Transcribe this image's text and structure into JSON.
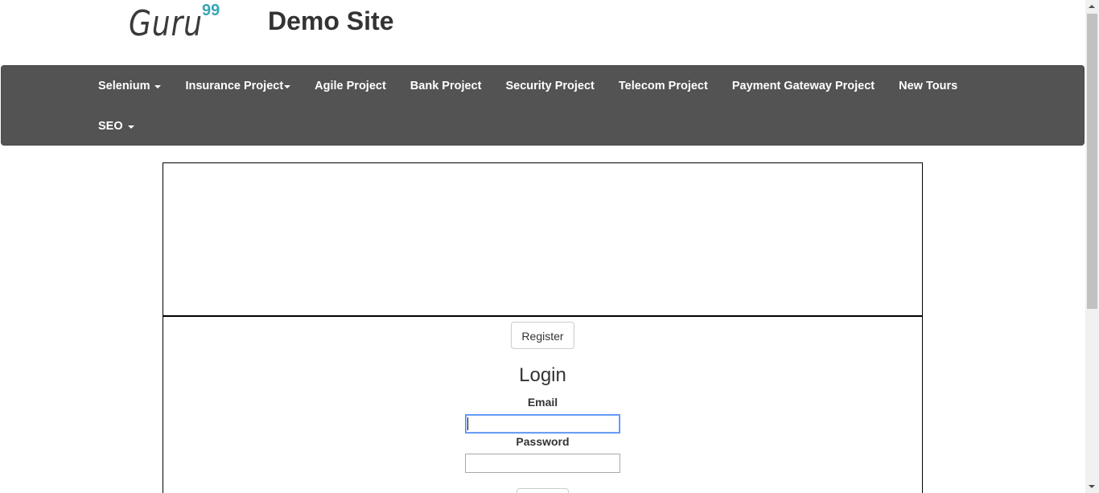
{
  "header": {
    "logo_text": "Guru",
    "logo_sup": "99",
    "title": "Demo Site"
  },
  "nav": {
    "row1": [
      {
        "label": "Selenium",
        "dropdown": true
      },
      {
        "label": "Insurance Project",
        "dropdown": true
      },
      {
        "label": "Agile Project",
        "dropdown": false
      },
      {
        "label": "Bank Project",
        "dropdown": false
      },
      {
        "label": "Security Project",
        "dropdown": false
      },
      {
        "label": "Telecom Project",
        "dropdown": false
      },
      {
        "label": "Payment Gateway Project",
        "dropdown": false
      },
      {
        "label": "New Tours",
        "dropdown": false
      }
    ],
    "row2": [
      {
        "label": "SEO",
        "dropdown": true
      }
    ]
  },
  "main": {
    "register_label": "Register",
    "login_title": "Login",
    "email_label": "Email",
    "email_value": "",
    "password_label": "Password",
    "password_value": ""
  },
  "colors": {
    "navbar_bg": "#535353",
    "logo_accent": "#3aa5b6",
    "focus_border": "#4d90fe"
  }
}
